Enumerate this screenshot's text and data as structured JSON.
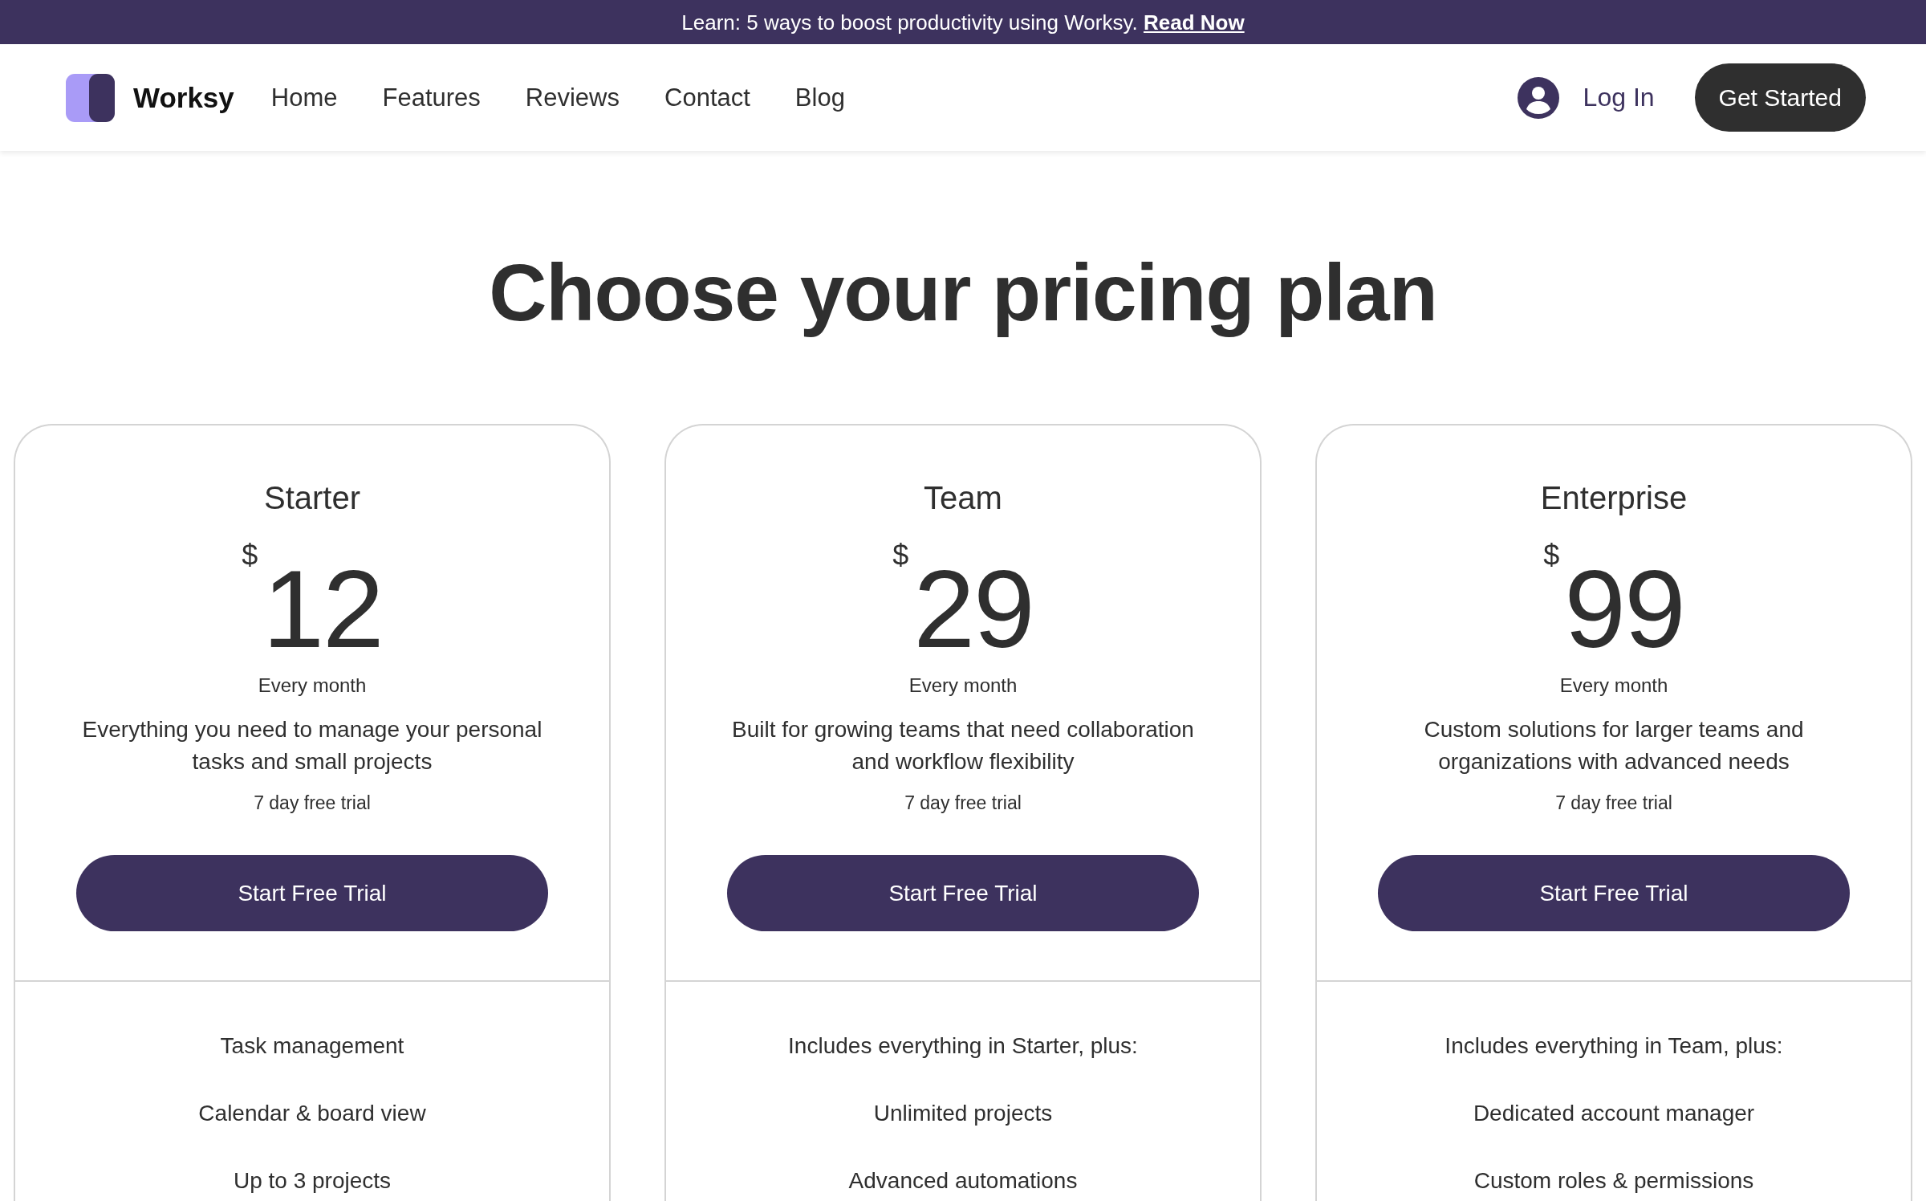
{
  "announcement_bar": {
    "text": "Learn: 5 ways to boost productivity using Worksy.",
    "link": "Read Now"
  },
  "header": {
    "logo_text": "Worksy",
    "nav_links": [
      "Home",
      "Features",
      "Reviews",
      "Contact",
      "Blog"
    ],
    "login": "Log In",
    "cta_button": "Get Started"
  },
  "heading": "Choose your pricing plan",
  "plans": [
    {
      "name": "Starter",
      "currency": "$",
      "price": "12",
      "period": "Every month",
      "description": "Everything you need to manage your personal tasks and small projects",
      "trial": "7 day free trial",
      "button": "Start Free Trial",
      "features": [
        "Task management",
        "Calendar & board view",
        "Up to 3 projects"
      ]
    },
    {
      "name": "Team",
      "currency": "$",
      "price": "29",
      "period": "Every month",
      "description": "Built for growing teams that need collaboration and workflow flexibility",
      "trial": "7 day free trial",
      "button": "Start Free Trial",
      "features": [
        "Includes everything in Starter, plus:",
        "Unlimited projects",
        "Advanced automations"
      ]
    },
    {
      "name": "Enterprise",
      "currency": "$",
      "price": "99",
      "period": "Every month",
      "description": "Custom solutions for larger teams and organizations with advanced needs",
      "trial": "7 day free trial",
      "button": "Start Free Trial",
      "features": [
        "Includes everything in Team, plus:",
        "Dedicated account manager",
        "Custom roles & permissions"
      ]
    }
  ]
}
